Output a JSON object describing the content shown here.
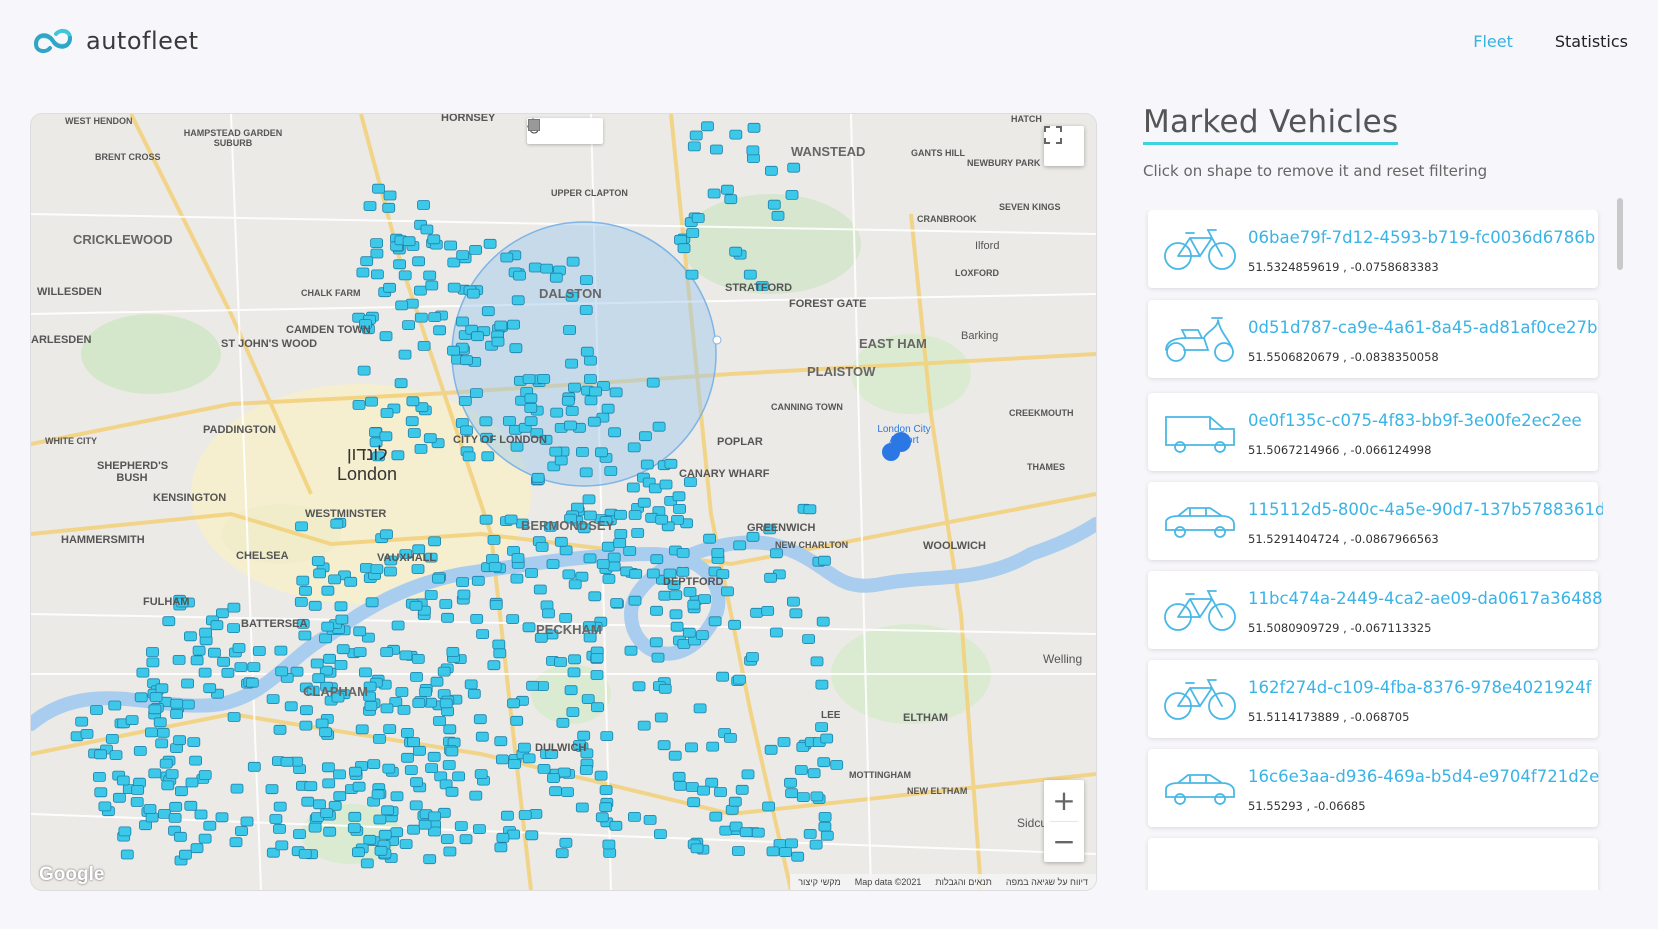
{
  "app": {
    "name": "autofleet"
  },
  "nav": {
    "fleet": "Fleet",
    "statistics": "Statistics"
  },
  "map": {
    "labels": {
      "london_he": "לונדון",
      "london": "London",
      "cricklewood": "CRICKLEWOOD",
      "willesden": "WILLESDEN",
      "harlesden": "ARLESDEN",
      "camden": "CAMDEN TOWN",
      "stjohns": "ST JOHN'S WOOD",
      "paddington": "PADDINGTON",
      "kensington": "KENSINGTON",
      "westminster": "WESTMINSTER",
      "hammersmith": "HAMMERSMITH",
      "fulham": "FULHAM",
      "chelsea": "CHELSEA",
      "battersea": "BATTERSEA",
      "clapham": "CLAPHAM",
      "cityoflondon": "CITY OF LONDON",
      "bermondsey": "BERMONDSEY",
      "peckham": "PECKHAM",
      "deptford": "DEPTFORD",
      "greenwich": "GREENWICH",
      "dalston": "DALSTON",
      "stratford": "STRATFORD",
      "forestgate": "FOREST GATE",
      "eastham": "EAST HAM",
      "plaistow": "PLAISTOW",
      "wanstead": "WANSTEAD",
      "barking": "Barking",
      "ilford": "Ilford",
      "woolwich": "WOOLWICH",
      "eltham": "ELTHAM",
      "canarywharf": "CANARY WHARF",
      "airport": "London City Airport",
      "dulwich": "DULWICH",
      "hornsey": "HORNSEY",
      "hampstead": "HAMPSTEAD GARDEN SUBURB",
      "westhendon": "WEST HENDON",
      "shepherds": "SHEPHERD'S BUSH",
      "whitecity": "WHITE CITY",
      "vauxhall": "VAUXHALL",
      "newcharlton": "NEW CHARLTON",
      "poplar": "POPLAR",
      "welling": "Welling",
      "sidcup": "Sidcup",
      "newham": "NEWBURY PARK",
      "sevenkings": "SEVEN KINGS",
      "loxford": "LOXFORD",
      "cranbrook": "CRANBROOK",
      "creekmouth": "CREEKMOUTH",
      "canningtown": "CANNING TOWN",
      "newEltham": "NEW ELTHAM",
      "mottingham": "MOTTINGHAM",
      "lee": "LEE",
      "upperclapton": "UPPER CLAPTON",
      "chalkfarm": "CHALK FARM",
      "brentcross": "BRENT CROSS",
      "thames": "THAMES",
      "hatch": "HATCH",
      "gantshill": "GANTS HILL"
    },
    "google": "Google",
    "footer": [
      "מקשי קיצור",
      "Map data ©2021",
      "תנאים והגבלות",
      "דיווח על שגיאה במפה"
    ]
  },
  "panel": {
    "title": "Marked Vehicles",
    "subtitle": "Click on shape to remove it and reset filtering",
    "vehicles": [
      {
        "id": "06bae79f-7d12-4593-b719-fc0036d6786b",
        "coords": "51.5324859619 , -0.0758683383",
        "type": "bicycle"
      },
      {
        "id": "0d51d787-ca9e-4a61-8a45-ad81af0ce27b",
        "coords": "51.5506820679 , -0.0838350058",
        "type": "scooter"
      },
      {
        "id": "0e0f135c-c075-4f83-bb9f-3e00fe2ec2ee",
        "coords": "51.5067214966 , -0.066124998",
        "type": "van"
      },
      {
        "id": "115112d5-800c-4a5e-90d7-137b5788361d",
        "coords": "51.5291404724 , -0.0867966563",
        "type": "car"
      },
      {
        "id": "11bc474a-2449-4ca2-ae09-da0617a36488",
        "coords": "51.5080909729 , -0.067113325",
        "type": "bicycle"
      },
      {
        "id": "162f274d-c109-4fba-8376-978e4021924f",
        "coords": "51.5114173889 , -0.068705",
        "type": "bicycle"
      },
      {
        "id": "16c6e3aa-d936-469a-b5d4-e9704f721d2e",
        "coords": "51.55293 , -0.06685",
        "type": "car"
      }
    ]
  },
  "colors": {
    "accent": "#38b2e0",
    "underline": "#3fd2e0",
    "vehicle": "#3cc8e8"
  }
}
